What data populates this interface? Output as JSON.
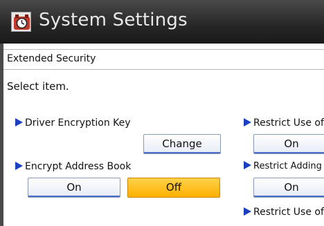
{
  "window": {
    "title": "System Settings",
    "icon": "settings-clock-icon"
  },
  "section": {
    "title": "Extended Security",
    "prompt": "Select item."
  },
  "items": {
    "driver_encryption_key": {
      "label": "Driver Encryption Key",
      "button": "Change"
    },
    "encrypt_address_book": {
      "label": "Encrypt Address Book",
      "on": "On",
      "off": "Off",
      "selected": "Off"
    },
    "restrict_use_1": {
      "label": "Restrict Use of",
      "on": "On"
    },
    "restrict_adding": {
      "label": "Restrict Adding of",
      "on": "On"
    },
    "restrict_use_2": {
      "label": "Restrict Use of"
    }
  },
  "colors": {
    "selected": "#ffb000",
    "arrow": "#1a3fbf",
    "titlebar": "#262626"
  }
}
